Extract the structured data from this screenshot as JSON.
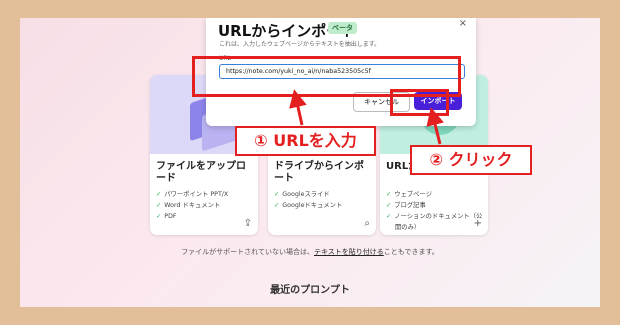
{
  "dialog": {
    "title": "URLからインポート",
    "badge": "ベータ",
    "close": "×",
    "subtitle": "これは、入力したウェブページからテキストを抽出します。",
    "url_label": "URL",
    "url_value": "https://note.com/yuki_no_ai/n/naba523505c5f",
    "cancel_label": "キャンセル",
    "import_label": "インポート"
  },
  "cards": [
    {
      "title": "ファイルをアップロード",
      "items": [
        "パワーポイント PPT/X",
        "Word ドキュメント",
        "PDF"
      ],
      "action_icon": "upload-icon",
      "action_glyph": "⇪",
      "color": "#d9d6f6"
    },
    {
      "title": "ドライブからインポート",
      "items": [
        "Googleスライド",
        "Googleドキュメント"
      ],
      "action_icon": "search-icon",
      "action_glyph": "⌕",
      "color": "#ecd6e9"
    },
    {
      "title": "URLからインポート",
      "badge": "ベータ",
      "items": [
        "ウェブページ",
        "ブログ記事",
        "ノーションのドキュメント（公",
        "開のみ）"
      ],
      "action_icon": "plus-icon",
      "action_glyph": "+",
      "color": "#bdeee0"
    }
  ],
  "footnote": {
    "prefix": "ファイルがサポートされていない場合は、",
    "link": "テキストを貼り付ける",
    "suffix": "こともできます。"
  },
  "recent_heading": "最近のプロンプト",
  "annotations": {
    "step1": "① URLを入力",
    "step2": "② クリック",
    "color": "#e41f1f"
  }
}
